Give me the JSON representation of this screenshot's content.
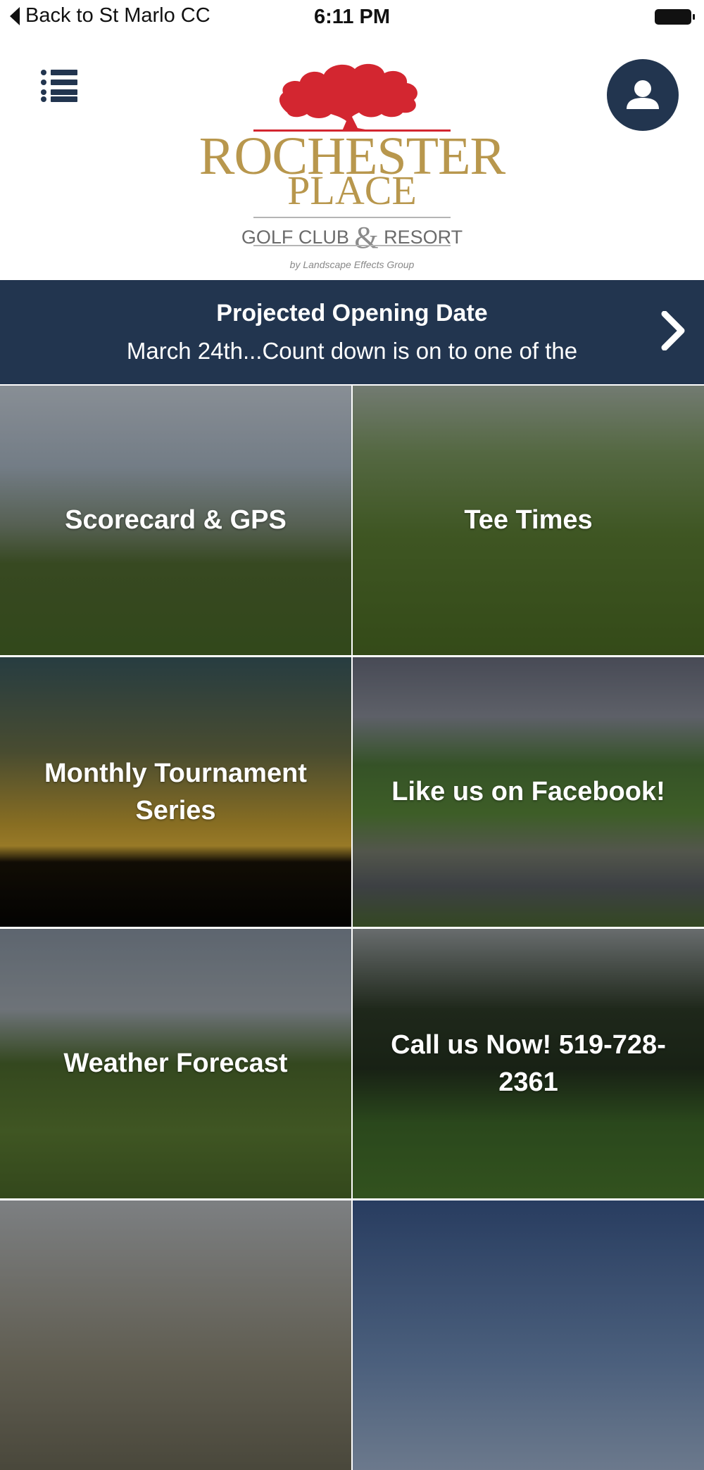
{
  "status_bar": {
    "back_label": "Back to St Marlo CC",
    "time": "6:11 PM"
  },
  "header": {
    "logo": {
      "title_line1": "ROCHESTER",
      "title_line2": "PLACE",
      "subtitle_left": "GOLF CLUB",
      "subtitle_amp": "&",
      "subtitle_right": "RESORT",
      "byline": "by Landscape Effects Group"
    },
    "menu_icon": "list-menu-icon",
    "profile_icon": "user-icon"
  },
  "banner": {
    "title": "Projected Opening Date",
    "text": "March 24th...Count down is on to one of the",
    "chevron_icon": "chevron-right-icon"
  },
  "tiles": [
    {
      "label": "Scorecard & GPS"
    },
    {
      "label": "Tee Times"
    },
    {
      "label": "Monthly Tournament Series"
    },
    {
      "label": "Like us on Facebook!"
    },
    {
      "label": "Weather Forecast"
    },
    {
      "label": "Call us Now! 519-728-2361"
    },
    {
      "label": ""
    },
    {
      "label": ""
    }
  ],
  "colors": {
    "navy": "#22354f",
    "logo_gold": "#b8974d",
    "logo_red": "#d32630",
    "text_on_dark": "#ffffff"
  }
}
